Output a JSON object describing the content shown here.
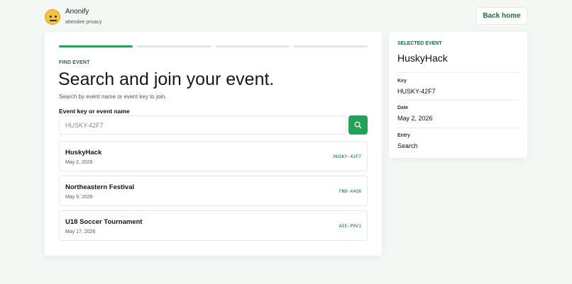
{
  "app": {
    "name": "Anonify",
    "tagline": "attendee privacy",
    "back_label": "Back home"
  },
  "progress": {
    "steps": 4,
    "current_step": 1
  },
  "find": {
    "eyebrow": "FIND EVENT",
    "title": "Search and join your event.",
    "subtitle": "Search by event name or event key to join.",
    "field_label": "Event key or event name",
    "search_value": "HUSKY-42F7",
    "search_placeholder": "HUSKY-42F7"
  },
  "events": [
    {
      "name": "HuskyHack",
      "date": "May 2, 2026",
      "key": "HUSKY-42F7"
    },
    {
      "name": "Northeastern Festival",
      "date": "May 9, 2026",
      "key": "FND-X4Q8"
    },
    {
      "name": "U18 Soccer Tournament",
      "date": "May 17, 2026",
      "key": "AIE-P9V1"
    }
  ],
  "selected": {
    "eyebrow": "SELECTED EVENT",
    "name": "HuskyHack",
    "key_label": "Key",
    "key": "HUSKY-42F7",
    "date_label": "Date",
    "date": "May 2, 2026",
    "entry_label": "Entry",
    "entry": "Search"
  },
  "colors": {
    "accent": "#1fa455",
    "accent_dark": "#1f6b3a",
    "background": "#f4f8f4"
  }
}
